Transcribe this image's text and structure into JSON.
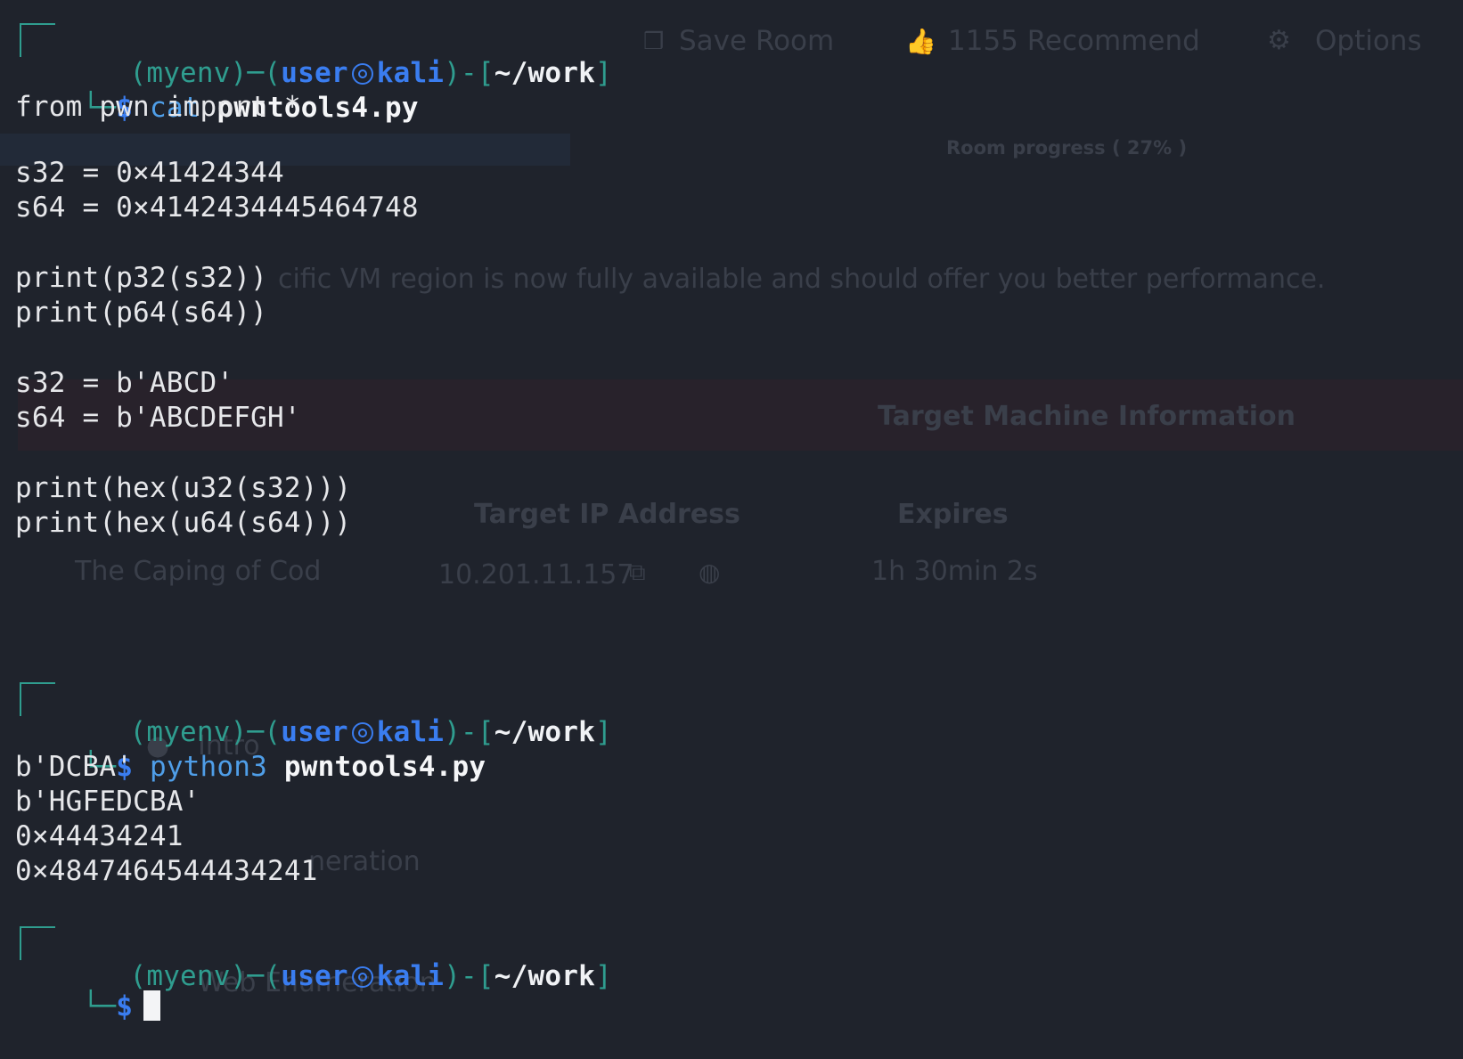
{
  "background_page": {
    "save_room": "Save Room",
    "recommend": "1155 Recommend",
    "options": "Options",
    "room_progress": "Room progress ( 27% )",
    "region_notice": "cific VM region is now fully available and should offer you better performance.",
    "target_machine_info": "Target Machine Information",
    "target_ip_header": "Target IP Address",
    "expires_header": "Expires",
    "machine_name": "The Caping of Cod",
    "target_ip": "10.201.11.157",
    "expires_value": "1h 30min 2s",
    "task_intro": "Intro",
    "task_enum": "neration",
    "task_web": "Web Enumeration"
  },
  "terminal": {
    "prompt": {
      "env": "(myenv)",
      "user": "user",
      "host": "kali",
      "path": "~/work",
      "dollar": "$"
    },
    "commands": [
      {
        "cmd": "cat",
        "arg": "pwntools4.py"
      },
      {
        "cmd": "python3",
        "arg": "pwntools4.py"
      }
    ],
    "file_lines": [
      "from pwn import *",
      "",
      "s32 = 0×41424344",
      "s64 = 0×4142434445464748",
      "",
      "print(p32(s32))",
      "print(p64(s64))",
      "",
      "s32 = b'ABCD'",
      "s64 = b'ABCDEFGH'",
      "",
      "print(hex(u32(s32)))",
      "print(hex(u64(s64)))"
    ],
    "output_lines": [
      "b'DCBA'",
      "b'HGFEDCBA'",
      "0×44434241",
      "0×4847464544434241"
    ]
  },
  "colors": {
    "background": "#1f232c",
    "prompt_frame": "#2f9d8f",
    "prompt_user": "#3a7df0",
    "command": "#4f9ee8",
    "text": "#e6e7ea"
  }
}
